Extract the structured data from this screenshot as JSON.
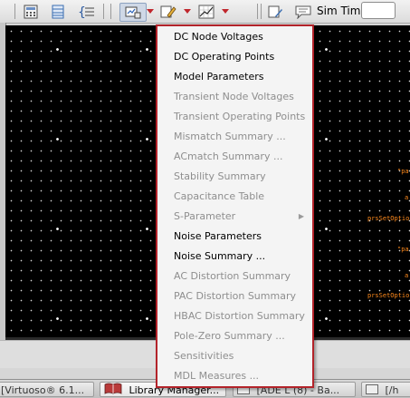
{
  "toolbar": {
    "sim_time_label": "Sim Time",
    "sim_time_value": ""
  },
  "menu": {
    "items": [
      {
        "label": "DC Node Voltages",
        "enabled": true
      },
      {
        "label": "DC Operating Points",
        "enabled": true
      },
      {
        "label": "Model Parameters",
        "enabled": true
      },
      {
        "label": "Transient Node Voltages",
        "enabled": false
      },
      {
        "label": "Transient Operating Points",
        "enabled": false
      },
      {
        "label": "Mismatch Summary ...",
        "enabled": false
      },
      {
        "label": "ACmatch Summary ...",
        "enabled": false
      },
      {
        "label": "Stability Summary",
        "enabled": false
      },
      {
        "label": "Capacitance Table",
        "enabled": false
      },
      {
        "label": "S-Parameter",
        "enabled": false,
        "submenu": true
      },
      {
        "label": "Noise Parameters",
        "enabled": true
      },
      {
        "label": "Noise Summary ...",
        "enabled": true
      },
      {
        "label": "AC Distortion Summary",
        "enabled": false
      },
      {
        "label": "PAC Distortion Summary",
        "enabled": false
      },
      {
        "label": "HBAC Distortion Summary",
        "enabled": false
      },
      {
        "label": "Pole-Zero Summary ...",
        "enabled": false
      },
      {
        "label": "Sensitivities",
        "enabled": false
      },
      {
        "label": "MDL Measures ...",
        "enabled": false
      }
    ]
  },
  "canvas_text": {
    "t1": "\"pa",
    "t2": "a",
    "t3": "prsSetOption",
    "t4": "\"pa",
    "t5": "a",
    "t6": "prsSetOption"
  },
  "taskbar": {
    "items": [
      {
        "label": "[Virtuoso® 6.1..."
      },
      {
        "label": "Library Manager..."
      },
      {
        "label": "[ADE L (8) - Ba..."
      },
      {
        "label": "[/h"
      }
    ]
  },
  "colors": {
    "menu_border": "#b3232a",
    "canvas_bg": "#000000",
    "canvas_label": "#ff8a1c"
  }
}
